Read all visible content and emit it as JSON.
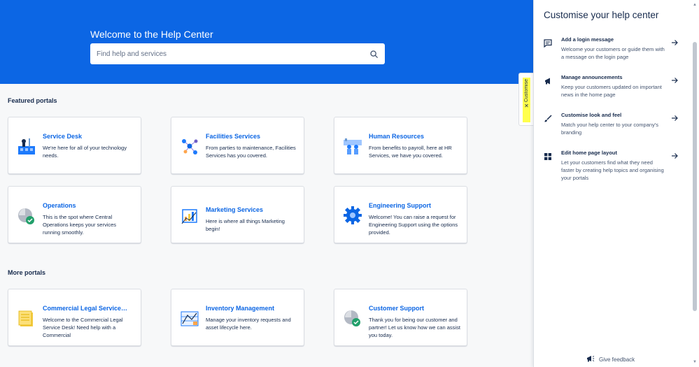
{
  "hero": {
    "title": "Welcome to the Help Center",
    "search_placeholder": "Find help and services"
  },
  "featured": {
    "heading": "Featured portals",
    "portals": [
      {
        "title": "Service Desk",
        "description": "We're here for all of your technology needs."
      },
      {
        "title": "Facilities Services",
        "description": "From parties to maintenance, Facilities Services has you covered."
      },
      {
        "title": "Human Resources",
        "description": "From benefits to payroll, here at HR Services, we have you covered."
      },
      {
        "title": "Operations",
        "description": "This is the spot where Central Operations keeps your services running smoothly."
      },
      {
        "title": "Marketing Services",
        "description": "Here is where all things Marketing begin!"
      },
      {
        "title": "Engineering Support",
        "description": "Welcome! You can raise a request for Engineering Support using the options provided."
      }
    ]
  },
  "more": {
    "heading": "More portals",
    "portals": [
      {
        "title": "Commercial Legal Service…",
        "description": "Welcome to the Commercial Legal Service Desk! Need help with a Commercial"
      },
      {
        "title": "Inventory Management",
        "description": "Manage your inventory requests and asset lifecycle here."
      },
      {
        "title": "Customer Support",
        "description": "Thank you for being our customer and partner! Let us know how we can assist you today."
      }
    ]
  },
  "customise_tab": {
    "label": "Customise"
  },
  "panel": {
    "title": "Customise your help center",
    "items": [
      {
        "title": "Add a login message",
        "description": "Welcome your customers or guide them with a message on the login page"
      },
      {
        "title": "Manage announcements",
        "description": "Keep your customers updated on important news in the home page"
      },
      {
        "title": "Customise look and feel",
        "description": "Match your help center to your company's branding"
      },
      {
        "title": "Edit home page layout",
        "description": "Let your customers find what they need faster by creating help topics and organising your portals"
      }
    ],
    "feedback_label": "Give feedback"
  },
  "colors": {
    "brand": "#0c66e4",
    "highlight": "#ffff4d"
  }
}
